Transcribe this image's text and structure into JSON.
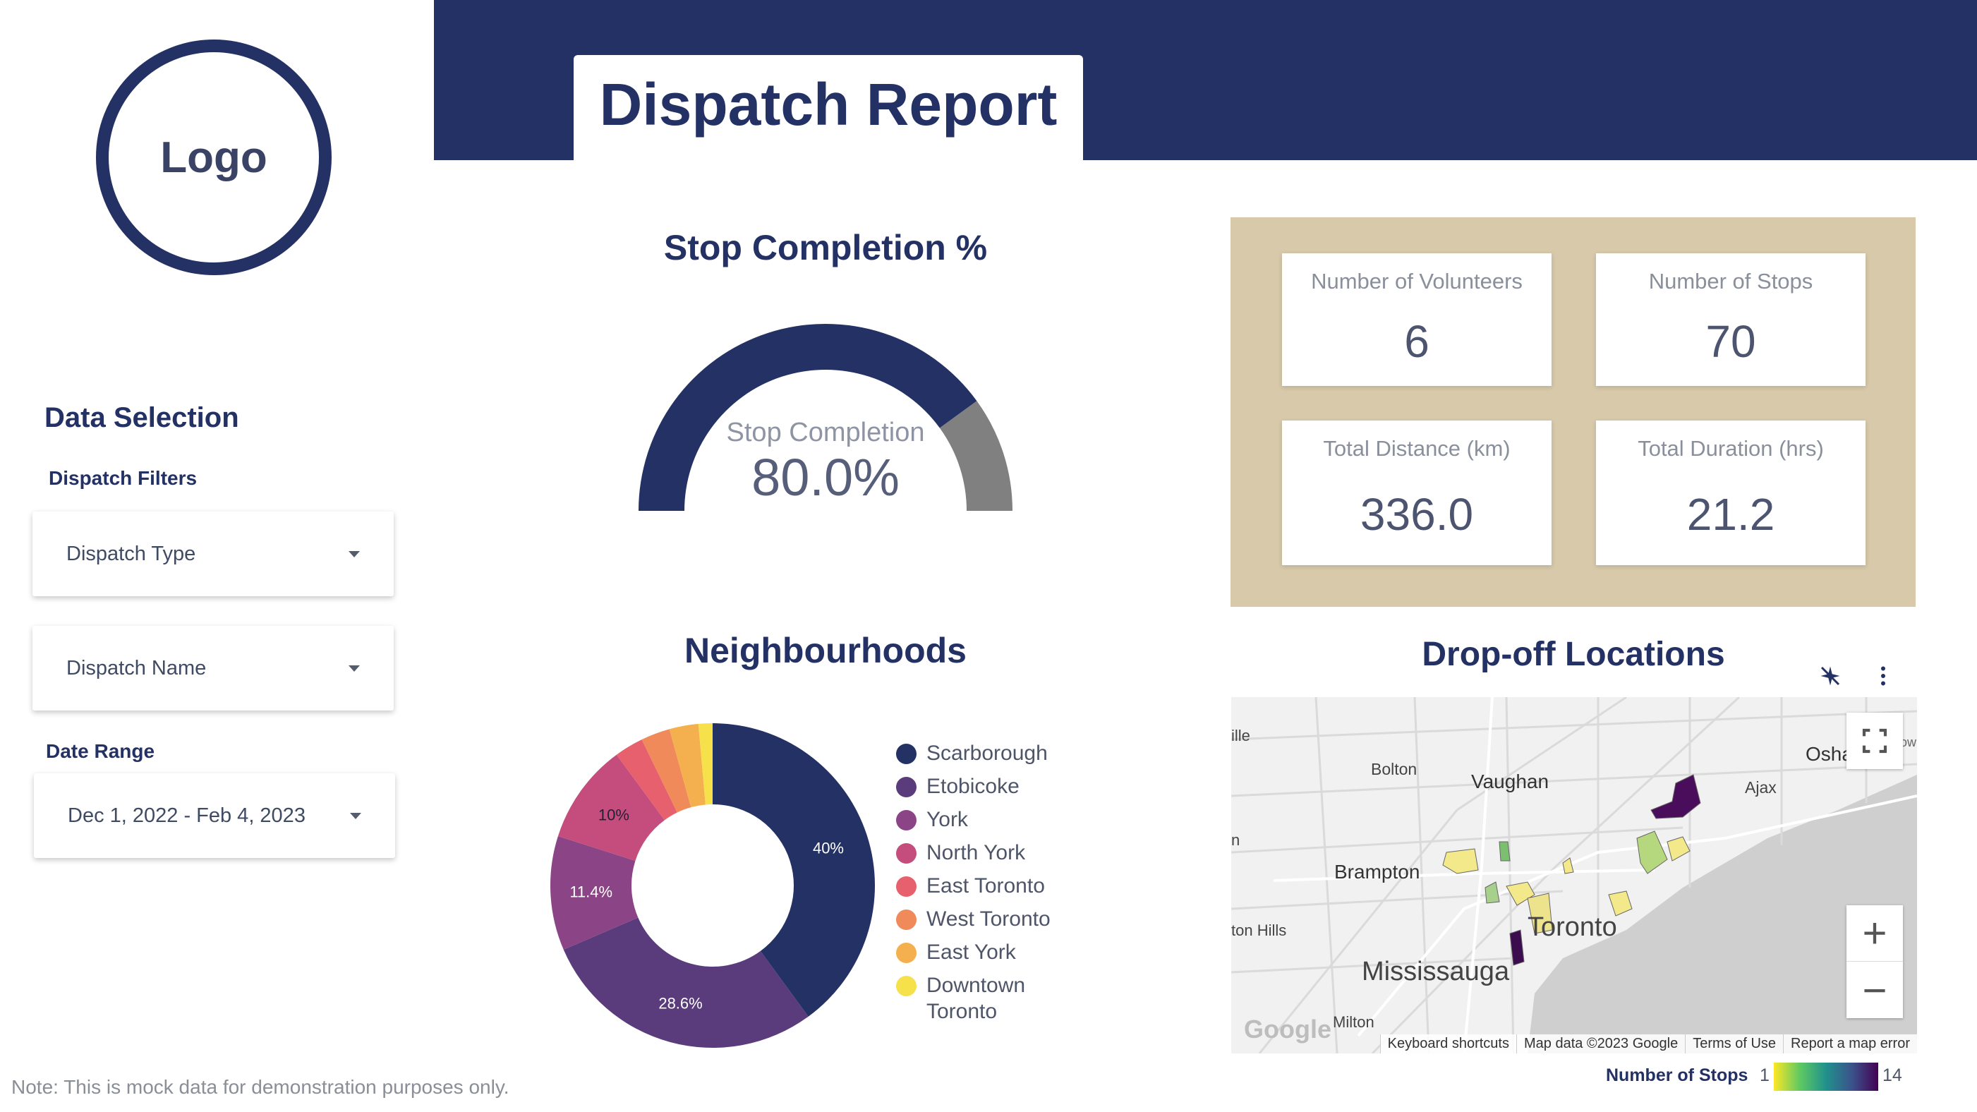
{
  "header": {
    "title": "Dispatch Report",
    "logo_text": "Logo"
  },
  "filters": {
    "section_title": "Data Selection",
    "dispatch_filters_label": "Dispatch Filters",
    "dispatch_type": "Dispatch Type",
    "dispatch_name": "Dispatch Name",
    "date_range_label": "Date Range",
    "date_range_value": "Dec 1, 2022 - Feb 4, 2023"
  },
  "gauge": {
    "title": "Stop Completion %",
    "label": "Stop Completion",
    "value_text": "80.0%",
    "value": 0.8,
    "colors": {
      "fill": "#243164",
      "rest": "#808080"
    }
  },
  "kpis": [
    {
      "label": "Number of Volunteers",
      "value": "6"
    },
    {
      "label": "Number of Stops",
      "value": "70"
    },
    {
      "label": "Total Distance (km)",
      "value": "336.0"
    },
    {
      "label": "Total Duration (hrs)",
      "value": "21.2"
    }
  ],
  "neighbourhoods": {
    "title": "Neighbourhoods"
  },
  "chart_data": {
    "type": "pie",
    "title": "Neighbourhoods",
    "categories": [
      "Scarborough",
      "Etobicoke",
      "York",
      "North York",
      "East Toronto",
      "West Toronto",
      "East York",
      "Downtown Toronto"
    ],
    "values": [
      40,
      28.6,
      11.4,
      10,
      2.9,
      2.9,
      2.9,
      1.4
    ],
    "data_labels": [
      "40%",
      "28.6%",
      "11.4%",
      "10%",
      "",
      "",
      "",
      ""
    ],
    "colors": [
      "#243164",
      "#5a3b7c",
      "#8b4586",
      "#c44d7d",
      "#e7606e",
      "#f08a5b",
      "#f4b04e",
      "#f6e14a"
    ],
    "legend": "right",
    "donut": true
  },
  "map": {
    "title": "Drop-off Locations",
    "places": [
      "ille",
      "Bolton",
      "Vaughan",
      "Osha",
      "Ajax",
      "ow",
      "Brampton",
      "n",
      "ton Hills",
      "Toronto",
      "Mississauga",
      "Milton"
    ],
    "google_logo": "Google",
    "footer": [
      "Keyboard shortcuts",
      "Map data ©2023 Google",
      "Terms of Use",
      "Report a map error"
    ],
    "zoom_in": "+",
    "zoom_out": "−",
    "scale_title": "Number of Stops",
    "scale_min": "1",
    "scale_max": "14"
  },
  "note": "Note: This is mock data for demonstration purposes only."
}
